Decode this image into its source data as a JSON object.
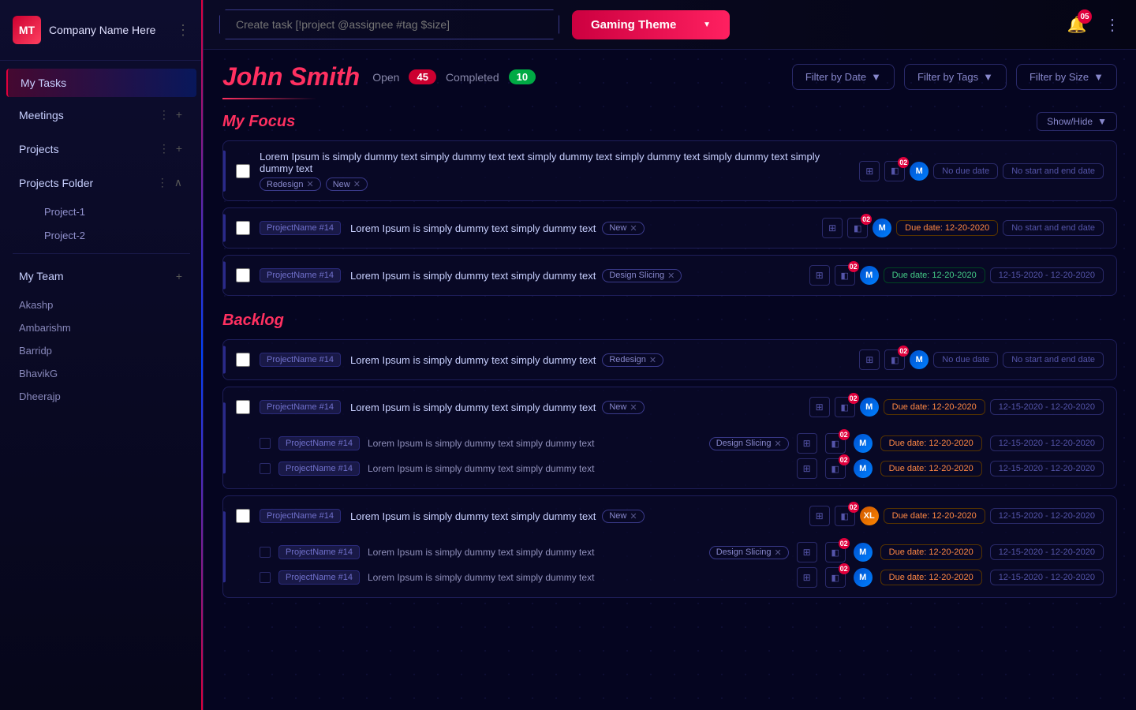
{
  "app": {
    "logo_text": "MT",
    "company_name": "Company Name Here"
  },
  "sidebar": {
    "nav_items": [
      {
        "id": "my-tasks",
        "label": "My Tasks",
        "active": true
      },
      {
        "id": "meetings",
        "label": "Meetings"
      },
      {
        "id": "projects",
        "label": "Projects"
      },
      {
        "id": "projects-folder",
        "label": "Projects Folder",
        "expanded": true
      }
    ],
    "sub_items": [
      {
        "label": "Project-1"
      },
      {
        "label": "Project-2"
      }
    ],
    "my_team_label": "My Team",
    "team_members": [
      "Akashp",
      "Ambarishm",
      "Barridp",
      "BhavikG",
      "Dheerajp"
    ]
  },
  "topbar": {
    "create_task_placeholder": "Create task [!project @assignee #tag $size]",
    "gaming_theme_label": "Gaming Theme",
    "notification_count": "05",
    "filter_date_label": "Filter by Date",
    "filter_tags_label": "Filter by Tags",
    "filter_size_label": "Filter by Size"
  },
  "page_header": {
    "title": "John Smith",
    "open_label": "Open",
    "open_count": "45",
    "completed_label": "Completed",
    "completed_count": "10"
  },
  "sections": {
    "my_focus": {
      "title": "My Focus",
      "show_hide_label": "Show/Hide",
      "tasks": [
        {
          "id": "mf1",
          "text_long": "Lorem Ipsum is simply dummy text simply dummy text text simply dummy text simply dummy text simply dummy text simply dummy text",
          "tags": [
            "Redesign",
            "New"
          ],
          "actions": {
            "sub_count": "02",
            "assignee": "M"
          },
          "due": "No due date",
          "due_type": "no-date",
          "range": "No start and end date"
        },
        {
          "id": "mf2",
          "project": "ProjectName #14",
          "text": "Lorem Ipsum is simply dummy text simply dummy text",
          "tags": [
            "New"
          ],
          "actions": {
            "sub_count": "02",
            "assignee": "M"
          },
          "due": "Due date: 12-20-2020",
          "due_type": "orange",
          "range": "No start and end date"
        },
        {
          "id": "mf3",
          "project": "ProjectName #14",
          "text": "Lorem Ipsum is simply dummy text simply dummy text",
          "tags": [
            "Design Slicing"
          ],
          "actions": {
            "sub_count": "02",
            "assignee": "M"
          },
          "due": "Due date: 12-20-2020",
          "due_type": "green",
          "range": "12-15-2020 - 12-20-2020"
        }
      ]
    },
    "backlog": {
      "title": "Backlog",
      "tasks": [
        {
          "id": "bl1",
          "project": "ProjectName #14",
          "text": "Lorem Ipsum is simply dummy text simply dummy text",
          "tags": [
            "Redesign"
          ],
          "actions": {
            "sub_count": "02",
            "assignee": "M"
          },
          "due": "No due date",
          "due_type": "no-date",
          "range": "No start and end date"
        },
        {
          "id": "bl2",
          "project": "ProjectName #14",
          "text": "Lorem Ipsum is simply dummy text simply dummy text",
          "tags": [
            "New"
          ],
          "actions": {
            "sub_count": "02",
            "assignee": "M"
          },
          "due": "Due date: 12-20-2020",
          "due_type": "orange",
          "range": "12-15-2020 - 12-20-2020",
          "sub_tasks": [
            {
              "project": "ProjectName #14",
              "text": "Lorem Ipsum is simply dummy text simply dummy text",
              "tags": [
                "Design Slicing"
              ],
              "due": "Due date: 12-20-2020",
              "range": "12-15-2020 - 12-20-2020",
              "sub_count": "02",
              "assignee": "M"
            },
            {
              "project": "ProjectName #14",
              "text": "Lorem Ipsum is simply dummy text simply dummy text",
              "tags": [],
              "due": "Due date: 12-20-2020",
              "range": "12-15-2020 - 12-20-2020",
              "sub_count": "02",
              "assignee": "M"
            }
          ]
        },
        {
          "id": "bl3",
          "project": "ProjectName #14",
          "text": "Lorem Ipsum is simply dummy text simply dummy text",
          "tags": [
            "New"
          ],
          "actions": {
            "sub_count": "02",
            "assignee": "XL",
            "assignee_type": "xl"
          },
          "due": "Due date: 12-20-2020",
          "due_type": "orange",
          "range": "12-15-2020 - 12-20-2020",
          "sub_tasks": [
            {
              "project": "ProjectName #14",
              "text": "Lorem Ipsum is simply dummy text simply dummy text",
              "tags": [
                "Design Slicing"
              ],
              "due": "Due date: 12-20-2020",
              "range": "12-15-2020 - 12-20-2020",
              "sub_count": "02",
              "assignee": "M"
            },
            {
              "project": "ProjectName #14",
              "text": "Lorem Ipsum is simply dummy text simply dummy text",
              "tags": [],
              "due": "Due date: 12-20-2020",
              "range": "12-15-2020 - 12-20-2020",
              "sub_count": "02",
              "assignee": "M"
            }
          ]
        }
      ]
    }
  }
}
